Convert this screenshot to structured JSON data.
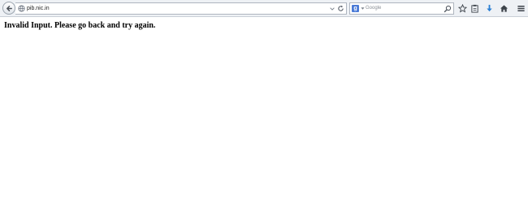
{
  "browser": {
    "url": "pib.nic.in",
    "search_placeholder": "Google",
    "search_engine_icon": "google-icon",
    "icons": [
      "back-icon",
      "globe-icon",
      "url-dropdown-icon",
      "reload-icon",
      "search-icon",
      "bookmark-star-icon",
      "reading-list-icon",
      "downloads-icon",
      "home-icon",
      "menu-icon"
    ],
    "accent_color": "#2a7fd4"
  },
  "page": {
    "message": "Invalid Input. Please go back and try again."
  }
}
